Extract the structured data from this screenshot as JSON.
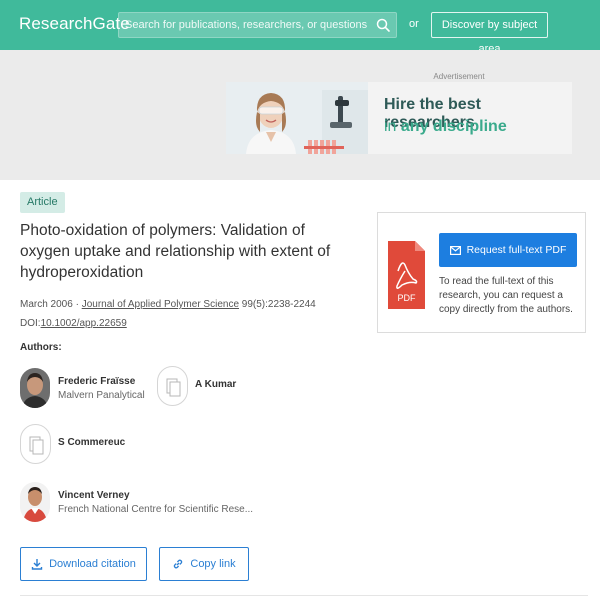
{
  "header": {
    "logo": "ResearchGate",
    "search_placeholder": "Search for publications, researchers, or questions",
    "or_text": "or",
    "discover_label": "Discover by subject area"
  },
  "ad": {
    "label": "Advertisement",
    "headline": "Hire the best researchers",
    "sub_prefix": "in ",
    "sub_bold": "any discipline"
  },
  "article": {
    "type_badge": "Article",
    "title": "Photo-oxidation of polymers: Validation of oxygen uptake and relationship with extent of hydroperoxidation",
    "date": "March 2006",
    "separator": " · ",
    "journal": "Journal of Applied Polymer Science",
    "citation": " 99(5):2238-2244",
    "doi_prefix": "DOI:",
    "doi": "10.1002/app.22659",
    "authors_label": "Authors:",
    "authors": [
      {
        "name": "Frederic Fraïsse",
        "institution": "Malvern Panalytical"
      },
      {
        "name": "A Kumar",
        "institution": ""
      },
      {
        "name": "S Commereuc",
        "institution": ""
      },
      {
        "name": "Vincent Verney",
        "institution": "French National Centre for Scientific Rese..."
      }
    ]
  },
  "actions": {
    "download_citation": "Download citation",
    "copy_link": "Copy link"
  },
  "request_panel": {
    "pdf_label": "PDF",
    "button_label": "Request full-text PDF",
    "description": "To read the full-text of this research, you can request a copy directly from the authors."
  },
  "colors": {
    "brand": "#40ba9b",
    "link_blue": "#2b7fd3",
    "request_blue": "#1d7ee0",
    "pdf_red": "#e04a3a"
  },
  "icons": {
    "search": "search-icon",
    "envelope": "envelope-icon",
    "download": "download-icon",
    "link": "link-icon",
    "pdf": "pdf-file-icon",
    "placeholder": "document-placeholder-icon"
  }
}
